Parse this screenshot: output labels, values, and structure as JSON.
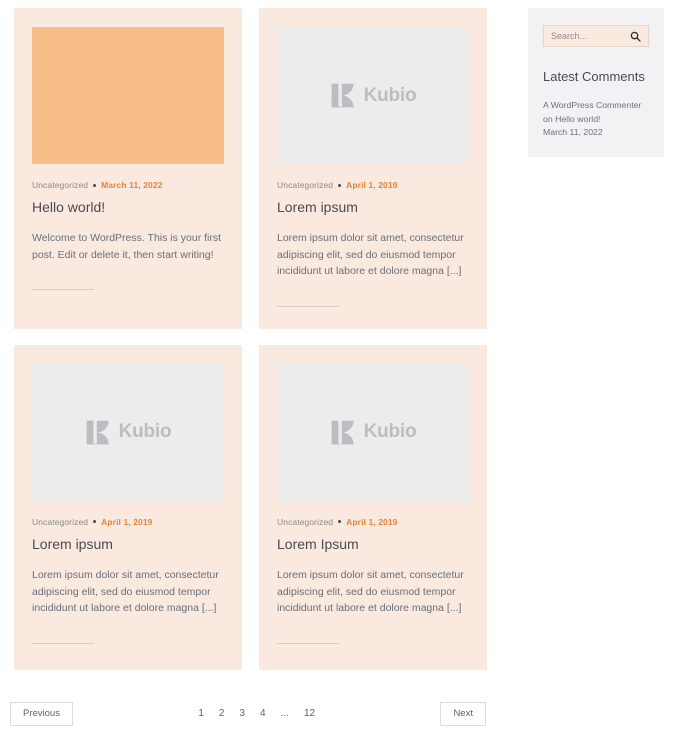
{
  "posts": [
    {
      "thumb_type": "solid-orange",
      "thumb_color": "#f7bd86",
      "category": "Uncategorized",
      "date": "March 11, 2022",
      "title": "Hello world!",
      "excerpt": "Welcome to WordPress. This is your first post. Edit or delete it, then start writing!"
    },
    {
      "thumb_type": "kubio-placeholder",
      "thumb_color": "#ececec",
      "logo_text": "Kubio",
      "category": "Uncategorized",
      "date": "April 1, 2019",
      "title": "Lorem ipsum",
      "excerpt": "Lorem ipsum dolor sit amet, consectetur adipiscing elit, sed do eiusmod tempor incididunt ut labore et dolore magna [...]"
    },
    {
      "thumb_type": "kubio-placeholder",
      "thumb_color": "#ececec",
      "logo_text": "Kubio",
      "category": "Uncategorized",
      "date": "April 1, 2019",
      "title": "Lorem ipsum",
      "excerpt": "Lorem ipsum dolor sit amet, consectetur adipiscing elit, sed do eiusmod tempor incididunt ut labore et dolore magna [...]"
    },
    {
      "thumb_type": "kubio-placeholder",
      "thumb_color": "#ececec",
      "logo_text": "Kubio",
      "category": "Uncategorized",
      "date": "April 1, 2019",
      "title": "Lorem Ipsum",
      "excerpt": "Lorem ipsum dolor sit amet, consectetur adipiscing elit, sed do eiusmod tempor incididunt ut labore et dolore magna [...]"
    }
  ],
  "sidebar": {
    "search": {
      "placeholder": "Search...",
      "value": "",
      "icon": "search-icon"
    },
    "comments_heading": "Latest Comments",
    "comments": [
      {
        "text": "A WordPress Commenter on Hello world!",
        "date": "March 11, 2022"
      }
    ]
  },
  "pagination": {
    "previous_label": "Previous",
    "next_label": "Next",
    "pages": [
      "1",
      "2",
      "3",
      "4"
    ],
    "ellipsis": "...",
    "last_page": "12"
  },
  "colors": {
    "card_bg": "#f9e9de",
    "accent_orange": "#e8833a",
    "thumb_gray": "#ececec",
    "sidebar_bg": "#f2f2f5",
    "logo_gray": "#bcbcc2"
  }
}
